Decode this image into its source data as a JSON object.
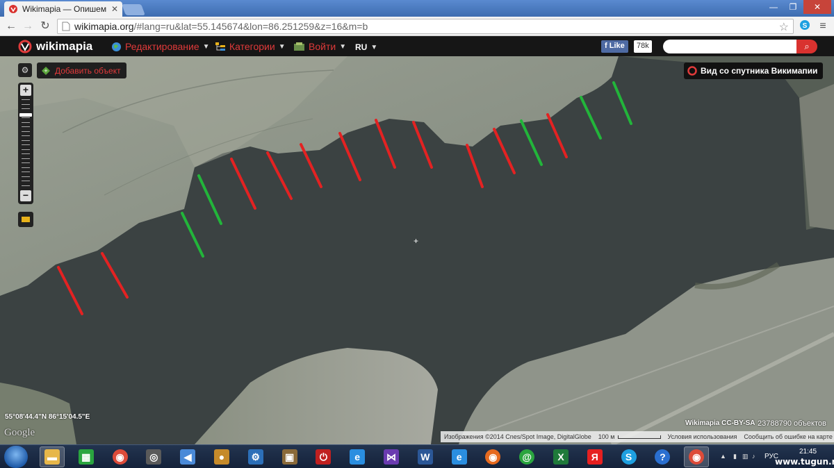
{
  "browser": {
    "tab_title": "Wikimapia — Опишем ве",
    "tab_close": "✕",
    "url_main": "wikimapia.org",
    "url_rest": "/#lang=ru&lat=55.145674&lon=86.251259&z=16&m=b",
    "window_controls": {
      "minimize": "—",
      "maximize": "❐",
      "close": "✕"
    }
  },
  "header": {
    "logo_text": "wikimapia",
    "menus": [
      {
        "label": "Редактирование",
        "icon": "globe-icon"
      },
      {
        "label": "Категории",
        "icon": "categories-icon"
      },
      {
        "label": "Войти",
        "icon": "login-icon"
      },
      {
        "label": "RU",
        "icon": ""
      }
    ],
    "fb_like_label": "Like",
    "fb_like_count": "78k",
    "search_placeholder": ""
  },
  "map": {
    "add_object_label": "Добавить объект",
    "satellite_view_label": "Вид со спутника Викимапии",
    "coordinates": "55°08'44.4\"N 86°15'04.5\"E",
    "google_logo": "Google",
    "license": "Wikimapia CC-BY-SA",
    "object_count": "23788790 объектов",
    "attribution": "Изображения ©2014 Cnes/Spot Image, DigitalGlobe",
    "scale_label": "100 м",
    "terms_label": "Условия использования",
    "report_label": "Сообщить об ошибке на карте",
    "colors": {
      "red_marker": "#e32222",
      "green_marker": "#22b53a",
      "water": "#3b4242",
      "land": "#8c9488"
    }
  },
  "taskbar": {
    "icons": [
      "explorer-icon",
      "store-icon",
      "chrome-icon",
      "speaker-icon",
      "volume-icon",
      "webcam-icon",
      "tool-icon",
      "game-icon",
      "power-icon",
      "ie-icon",
      "visual-studio-icon",
      "word-icon",
      "ie-icon",
      "firefox-icon",
      "mail-ru-icon",
      "excel-icon",
      "yandex-icon",
      "skype-icon",
      "help-icon",
      "chrome-icon"
    ],
    "tray_lang": "РУС",
    "time": "21:45",
    "watermark": "www.tugun.ru"
  }
}
